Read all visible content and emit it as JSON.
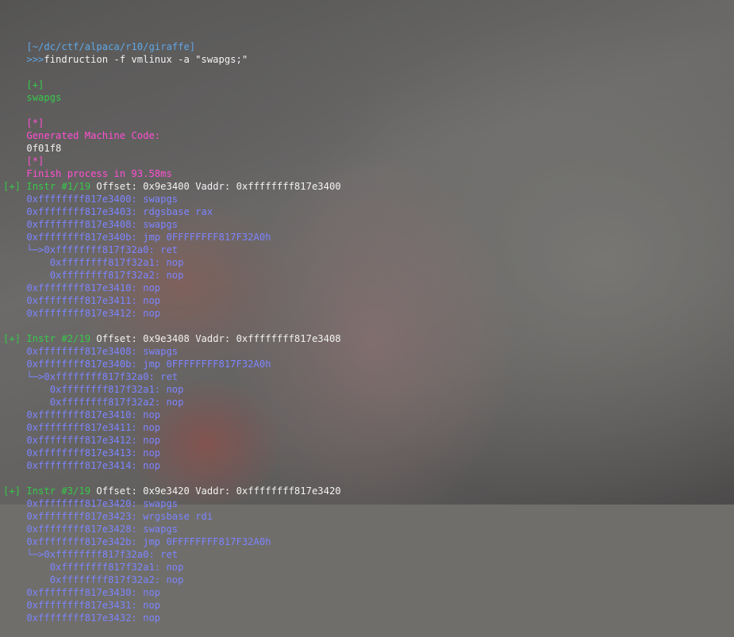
{
  "prompt": {
    "path": "[~/dc/ctf/alpaca/r10/giraffe]",
    "arrow": ">>>",
    "command": "findruction -f vmlinux -a \"swapgs;\""
  },
  "header": [
    {
      "tag": "[+]",
      "text": "swapgs",
      "color": "green"
    },
    {
      "tag": "[*]",
      "text": "Generated Machine Code:",
      "value": "0f01f8",
      "color": "magenta"
    },
    {
      "tag": "[*]",
      "text": "Finish process in 93.58ms",
      "color": "magenta"
    }
  ],
  "results": [
    {
      "tag": "[+]",
      "instr": "Instr #1/19",
      "offset_label": "Offset:",
      "offset": "0x9e3400",
      "vaddr_label": "Vaddr:",
      "vaddr": "0xffffffff817e3400",
      "lines": [
        {
          "depth": 0,
          "text": "0xffffffff817e3400: swapgs"
        },
        {
          "depth": 0,
          "text": "0xffffffff817e3403: rdgsbase rax"
        },
        {
          "depth": 0,
          "text": "0xffffffff817e3408: swapgs"
        },
        {
          "depth": 0,
          "text": "0xffffffff817e340b: jmp 0FFFFFFFF817F32A0h"
        },
        {
          "depth": 1,
          "prefix": "└─>",
          "text": "0xffffffff817f32a0: ret"
        },
        {
          "depth": 2,
          "text": "0xffffffff817f32a1: nop"
        },
        {
          "depth": 2,
          "text": "0xffffffff817f32a2: nop"
        },
        {
          "depth": 0,
          "text": "0xffffffff817e3410: nop"
        },
        {
          "depth": 0,
          "text": "0xffffffff817e3411: nop"
        },
        {
          "depth": 0,
          "text": "0xffffffff817e3412: nop"
        }
      ]
    },
    {
      "tag": "[+]",
      "instr": "Instr #2/19",
      "offset_label": "Offset:",
      "offset": "0x9e3408",
      "vaddr_label": "Vaddr:",
      "vaddr": "0xffffffff817e3408",
      "lines": [
        {
          "depth": 0,
          "text": "0xffffffff817e3408: swapgs"
        },
        {
          "depth": 0,
          "text": "0xffffffff817e340b: jmp 0FFFFFFFF817F32A0h"
        },
        {
          "depth": 1,
          "prefix": "└─>",
          "text": "0xffffffff817f32a0: ret"
        },
        {
          "depth": 2,
          "text": "0xffffffff817f32a1: nop"
        },
        {
          "depth": 2,
          "text": "0xffffffff817f32a2: nop"
        },
        {
          "depth": 0,
          "text": "0xffffffff817e3410: nop"
        },
        {
          "depth": 0,
          "text": "0xffffffff817e3411: nop"
        },
        {
          "depth": 0,
          "text": "0xffffffff817e3412: nop"
        },
        {
          "depth": 0,
          "text": "0xffffffff817e3413: nop"
        },
        {
          "depth": 0,
          "text": "0xffffffff817e3414: nop"
        }
      ]
    },
    {
      "tag": "[+]",
      "instr": "Instr #3/19",
      "offset_label": "Offset:",
      "offset": "0x9e3420",
      "vaddr_label": "Vaddr:",
      "vaddr": "0xffffffff817e3420",
      "lines": [
        {
          "depth": 0,
          "text": "0xffffffff817e3420: swapgs"
        },
        {
          "depth": 0,
          "text": "0xffffffff817e3423: wrgsbase rdi"
        },
        {
          "depth": 0,
          "text": "0xffffffff817e3428: swapgs"
        },
        {
          "depth": 0,
          "text": "0xffffffff817e342b: jmp 0FFFFFFFF817F32A0h"
        },
        {
          "depth": 1,
          "prefix": "└─>",
          "text": "0xffffffff817f32a0: ret"
        },
        {
          "depth": 2,
          "text": "0xffffffff817f32a1: nop"
        },
        {
          "depth": 2,
          "text": "0xffffffff817f32a2: nop"
        },
        {
          "depth": 0,
          "text": "0xffffffff817e3430: nop"
        },
        {
          "depth": 0,
          "text": "0xffffffff817e3431: nop"
        },
        {
          "depth": 0,
          "text": "0xffffffff817e3432: nop"
        }
      ]
    }
  ],
  "colors": {
    "path": "#5fa7e6",
    "command": "#f2f2f2",
    "success": "#37c94a",
    "info": "#ff4fd2",
    "disasm": "#7d84ff"
  }
}
